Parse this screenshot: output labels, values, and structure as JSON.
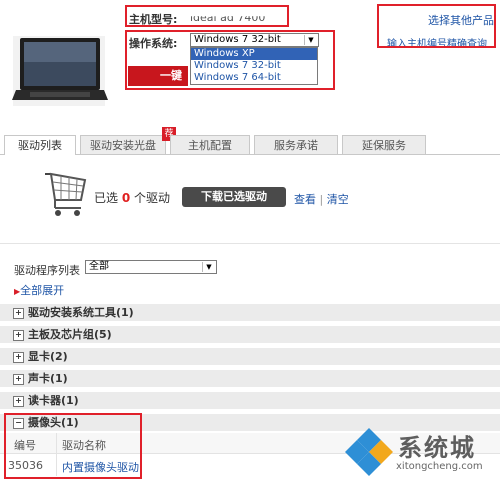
{
  "product": {
    "model_label": "主机型号:",
    "model_value": "ideal ad 7400",
    "os_label": "操作系统:",
    "os_selected": "Windows 7 32-bit",
    "os_options": [
      "Windows XP",
      "Windows 7 32-bit",
      "Windows 7 64-bit"
    ],
    "install_button": "一键"
  },
  "links": {
    "select_other": "选择其他产品",
    "enter_serial": "输入主机编号精确查询"
  },
  "tabs": [
    {
      "label": "驱动列表"
    },
    {
      "label": "驱动安装光盘",
      "badge": "荐"
    },
    {
      "label": "主机配置"
    },
    {
      "label": "服务承诺"
    },
    {
      "label": "延保服务"
    }
  ],
  "cart": {
    "selected_prefix": "已选",
    "count": "0",
    "selected_suffix": "个驱动",
    "download_button": "下载已选驱动",
    "view_link": "查看",
    "separator": "|",
    "clear_link": "清空"
  },
  "driver_list": {
    "label": "驱动程序列表",
    "filter_value": "全部",
    "expand_all": "全部展开"
  },
  "categories": [
    {
      "name": "驱动安装系统工具(1)",
      "sign": "+"
    },
    {
      "name": "主板及芯片组(5)",
      "sign": "+"
    },
    {
      "name": "显卡(2)",
      "sign": "+"
    },
    {
      "name": "声卡(1)",
      "sign": "+"
    },
    {
      "name": "读卡器(1)",
      "sign": "+"
    },
    {
      "name": "摄像头(1)",
      "sign": "−"
    }
  ],
  "camera_table": {
    "headers": [
      "编号",
      "驱动名称"
    ],
    "rows": [
      [
        "35036",
        "内置摄像头驱动"
      ]
    ]
  },
  "watermark": {
    "brand": "系统城",
    "url": "xitongcheng.com"
  },
  "colors": {
    "highlight_red": "#e0202a",
    "link_blue": "#1f55a6",
    "count_red": "#e02020",
    "selection_blue": "#3163b6"
  }
}
